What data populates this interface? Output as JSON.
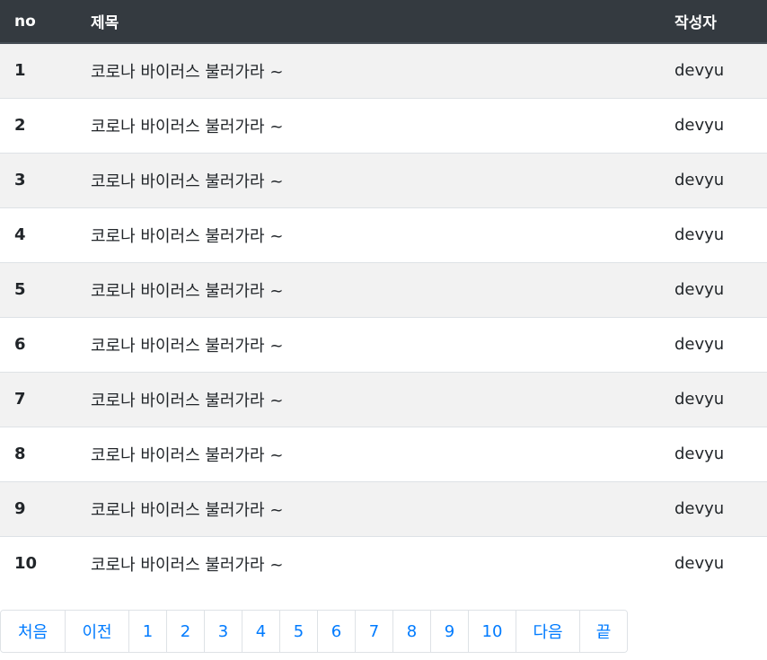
{
  "table": {
    "headers": {
      "no": "no",
      "title": "제목",
      "author": "작성자"
    },
    "rows": [
      {
        "no": "1",
        "title": "코로나 바이러스 불러가라 ~",
        "author": "devyu"
      },
      {
        "no": "2",
        "title": "코로나 바이러스 불러가라 ~",
        "author": "devyu"
      },
      {
        "no": "3",
        "title": "코로나 바이러스 불러가라 ~",
        "author": "devyu"
      },
      {
        "no": "4",
        "title": "코로나 바이러스 불러가라 ~",
        "author": "devyu"
      },
      {
        "no": "5",
        "title": "코로나 바이러스 불러가라 ~",
        "author": "devyu"
      },
      {
        "no": "6",
        "title": "코로나 바이러스 불러가라 ~",
        "author": "devyu"
      },
      {
        "no": "7",
        "title": "코로나 바이러스 불러가라 ~",
        "author": "devyu"
      },
      {
        "no": "8",
        "title": "코로나 바이러스 불러가라 ~",
        "author": "devyu"
      },
      {
        "no": "9",
        "title": "코로나 바이러스 불러가라 ~",
        "author": "devyu"
      },
      {
        "no": "10",
        "title": "코로나 바이러스 불러가라 ~",
        "author": "devyu"
      }
    ]
  },
  "pagination": {
    "first": "처음",
    "prev": "이전",
    "pages": [
      "1",
      "2",
      "3",
      "4",
      "5",
      "6",
      "7",
      "8",
      "9",
      "10"
    ],
    "next": "다음",
    "last": "끝"
  },
  "colors": {
    "header_bg": "#343a40",
    "stripe_bg": "#f2f2f2",
    "link": "#007bff"
  }
}
